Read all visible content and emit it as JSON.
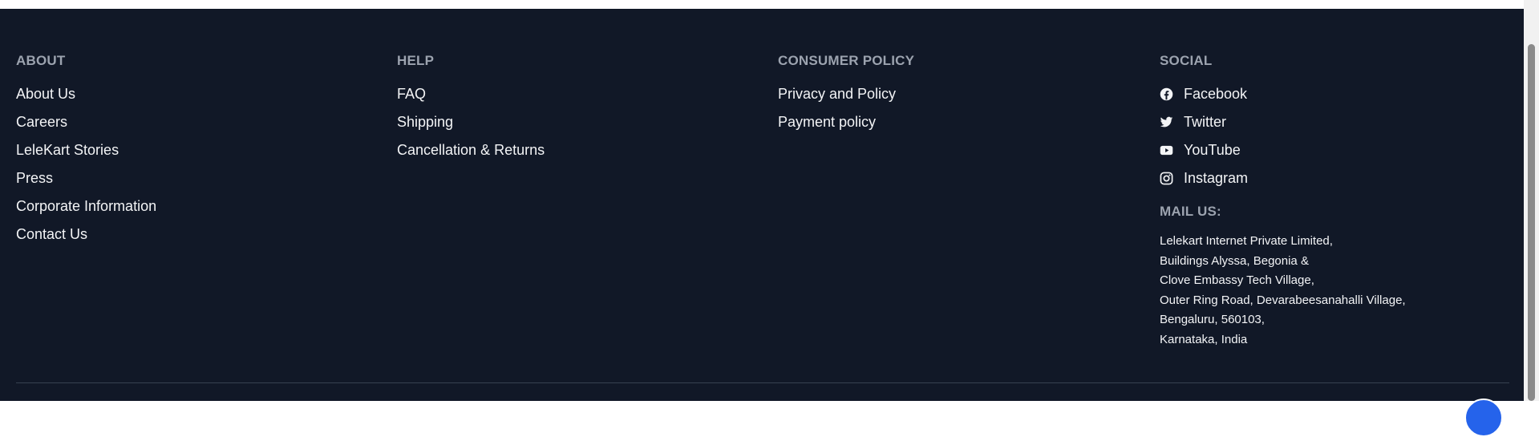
{
  "footer": {
    "about": {
      "title": "ABOUT",
      "links": [
        "About Us",
        "Careers",
        "LeleKart Stories",
        "Press",
        "Corporate Information",
        "Contact Us"
      ]
    },
    "help": {
      "title": "HELP",
      "links": [
        "FAQ",
        "Shipping",
        "Cancellation & Returns"
      ]
    },
    "consumer_policy": {
      "title": "CONSUMER POLICY",
      "links": [
        "Privacy and Policy",
        "Payment policy"
      ]
    },
    "social": {
      "title": "SOCIAL",
      "links": [
        {
          "label": "Facebook",
          "icon": "facebook-icon"
        },
        {
          "label": "Twitter",
          "icon": "twitter-icon"
        },
        {
          "label": "YouTube",
          "icon": "youtube-icon"
        },
        {
          "label": "Instagram",
          "icon": "instagram-icon"
        }
      ]
    },
    "mail": {
      "title": "MAIL US:",
      "address_lines": [
        "Lelekart Internet Private Limited,",
        "Buildings Alyssa, Begonia &",
        "Clove Embassy Tech Village,",
        "Outer Ring Road, Devarabeesanahalli Village,",
        "Bengaluru, 560103,",
        "Karnataka, India"
      ]
    }
  },
  "colors": {
    "footer_bg": "#111827",
    "heading": "#9ca3af",
    "text": "#f3f4f6",
    "divider": "#374151"
  }
}
